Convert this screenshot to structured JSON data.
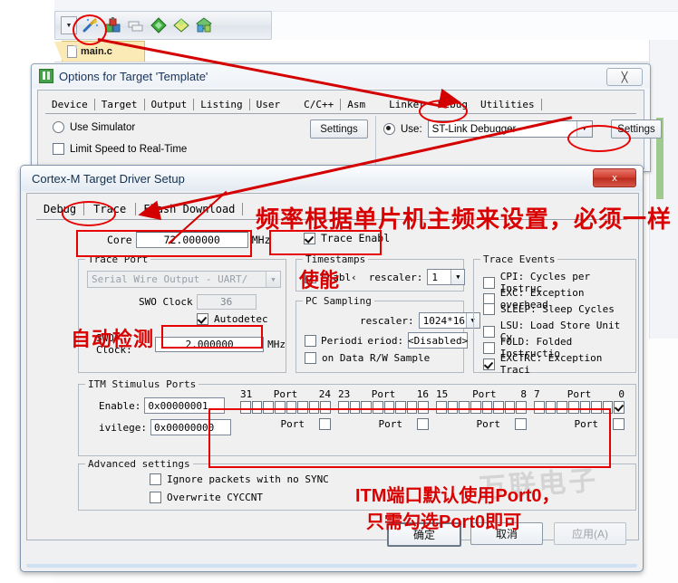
{
  "ide": {
    "toolbar": {
      "dropdown_icon": "chevron-down-icon",
      "icons": [
        "magic-wand-icon",
        "target-options-icon",
        "batch-build-icon",
        "green-diamond-icon",
        "yellow-diamond-icon",
        "manage-components-icon"
      ]
    },
    "file_tab": {
      "label": "main.c",
      "icon": "document-icon"
    }
  },
  "options_dialog": {
    "title": "Options for Target 'Template'",
    "app_icon": "keil-uvision-icon",
    "close_label": "╳",
    "tabs": [
      "Device",
      "Target",
      "Output",
      "Listing",
      "User",
      "C/C++",
      "Asm",
      "Linker",
      "Debug",
      "Utilities"
    ],
    "selected_tab": "Debug",
    "use_simulator_label": "Use Simulator",
    "use_simulator_checked": false,
    "limit_speed_label": "Limit Speed to Real-Time",
    "limit_speed_checked": false,
    "settings_left_label": "Settings",
    "use_label": "Use:",
    "use_checked": true,
    "debugger_value": "ST-Link Debugger",
    "settings_right_label": "Settings",
    "dropdown_glyph": "▼"
  },
  "cortex_dialog": {
    "title": "Cortex-M Target Driver Setup",
    "close_label": "x",
    "tabs": [
      "Debug",
      "Trace",
      "Flash Download"
    ],
    "selected_tab": "Trace",
    "core": {
      "label": "Core",
      "value": "72.000000",
      "unit": "MHz"
    },
    "trace_enable": {
      "label": "Trace Enabl",
      "checked": true
    },
    "trace_port": {
      "group_label": "Trace Port",
      "combo_value": "Serial Wire Output - UART/",
      "swo_clock_prescaler_label": "SWO Clock",
      "swo_clock_prescaler_value": "36",
      "autodetect_label": "Autodetec",
      "autodetect_checked": true,
      "swo_clock_label": "SWO Clock:",
      "swo_clock_value": "2.000000",
      "swo_clock_unit": "MHz"
    },
    "timestamps": {
      "group_label": "Timestamps",
      "enable_label": "Enabl‹",
      "enable_checked": true,
      "prescaler_label": "rescaler:",
      "prescaler_value": "1"
    },
    "pc_sampling": {
      "group_label": "PC Sampling",
      "prescaler_label": "rescaler:",
      "prescaler_value": "1024*16",
      "periodic_label": "Periodi",
      "periodic_checked": false,
      "period_label": "eriod:",
      "period_value": "<Disabled>",
      "data_rw_label": "on Data R/W Sample",
      "data_rw_checked": false
    },
    "trace_events": {
      "group_label": "Trace Events",
      "items": [
        {
          "label": "CPI: Cycles per Instruc",
          "checked": false
        },
        {
          "label": "EXC: Exception overhead",
          "checked": false
        },
        {
          "label": "SLEEP: Sleep Cycles",
          "checked": false
        },
        {
          "label": "LSU: Load Store Unit Cy",
          "checked": false
        },
        {
          "label": "FOLD: Folded Instructio",
          "checked": false
        },
        {
          "label": "EXCTRC: Exception Traci",
          "checked": true
        }
      ]
    },
    "itm": {
      "group_label": "ITM Stimulus Ports",
      "enable_label": "Enable:",
      "enable_value": "0x00000001",
      "privilege_label": "ivilege:",
      "privilege_value": "0x00000000",
      "port_label": "Port",
      "groups": [
        {
          "hi": "31",
          "lo": "24",
          "bits": [
            false,
            false,
            false,
            false,
            false,
            false,
            false,
            false
          ],
          "priv_checked": false
        },
        {
          "hi": "23",
          "lo": "16",
          "bits": [
            false,
            false,
            false,
            false,
            false,
            false,
            false,
            false
          ],
          "priv_checked": false
        },
        {
          "hi": "15",
          "lo": "8",
          "bits": [
            false,
            false,
            false,
            false,
            false,
            false,
            false,
            false
          ],
          "priv_checked": false
        },
        {
          "hi": "7",
          "lo": "0",
          "bits": [
            false,
            false,
            false,
            false,
            false,
            false,
            false,
            true
          ],
          "priv_checked": false
        }
      ]
    },
    "advanced": {
      "group_label": "Advanced settings",
      "ignore_label": "Ignore packets with no SYNC",
      "ignore_checked": false,
      "overwrite_label": "Overwrite CYCCNT",
      "overwrite_checked": false
    },
    "buttons": {
      "ok": "确定",
      "cancel": "取消",
      "apply": "应用(A)"
    }
  },
  "annotations": {
    "frequency_note": "频率根据单片机主频来设置，必须一样",
    "enable_note": "使能",
    "autodetect_note": "自动检测",
    "itm_note_line1": "ITM端口默认使用Port0，",
    "itm_note_line2": "只需勾选Port0即可"
  },
  "watermark": "万联电子",
  "colors": {
    "annotation_red": "#d80000",
    "highlight_red": "#e60000",
    "file_tab_yellow": "#fbe9b6",
    "title_blue": "#16325c"
  }
}
